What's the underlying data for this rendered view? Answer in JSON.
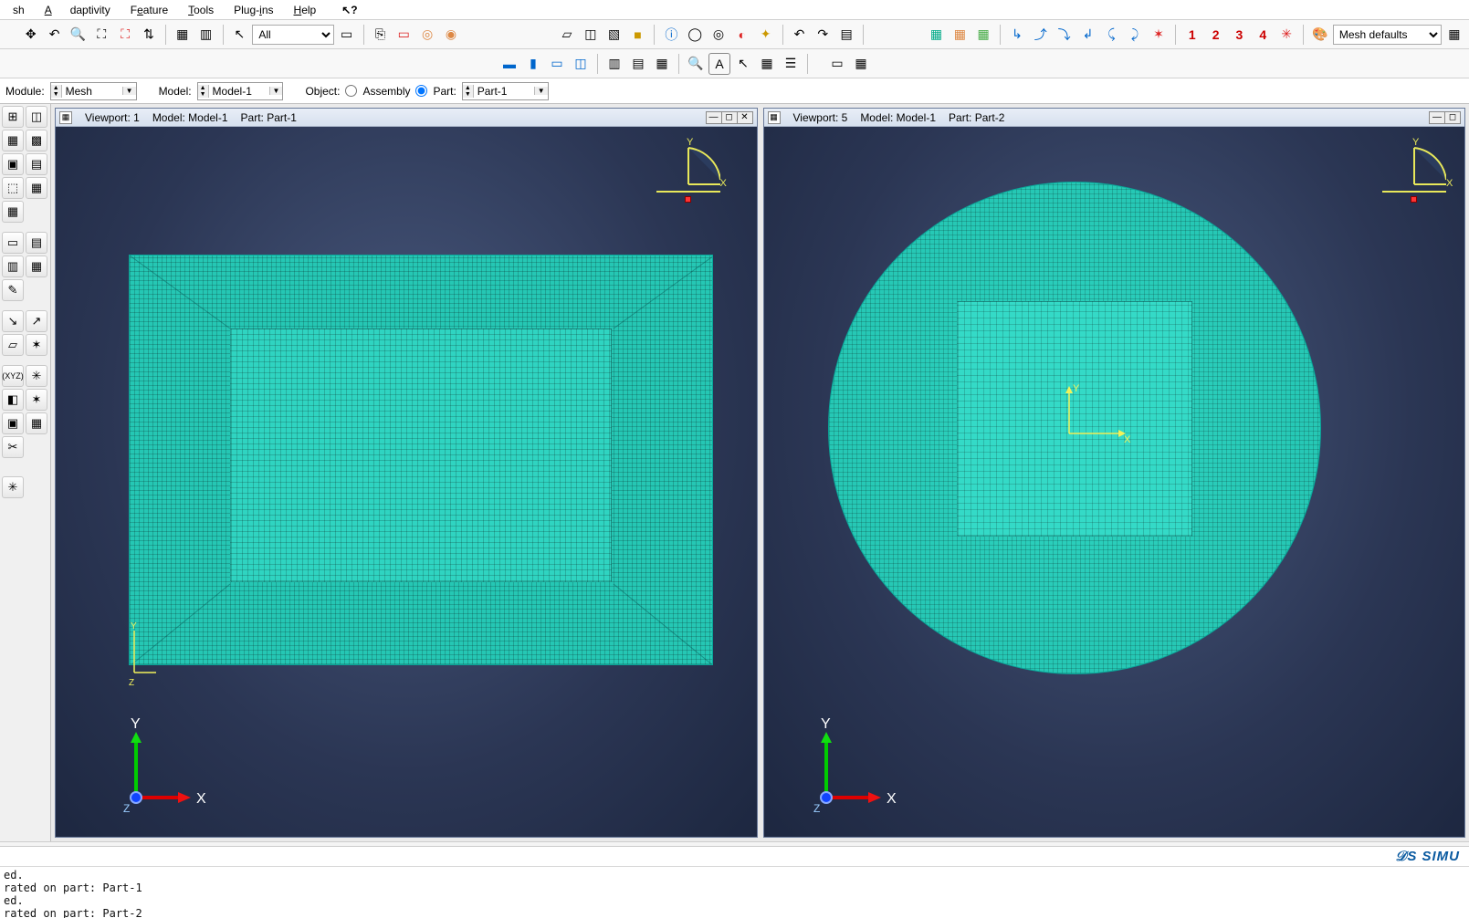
{
  "menu": {
    "items": [
      "sh",
      "Adaptivity",
      "Feature",
      "Tools",
      "Plug-ins",
      "Help"
    ],
    "help_marker": "⥀?"
  },
  "toolbar1": {
    "selector_label": "All",
    "render_style_label": "Mesh defaults"
  },
  "contextbar": {
    "module_label": "Module:",
    "module_value": "Mesh",
    "model_label": "Model:",
    "model_value": "Model-1",
    "object_label": "Object:",
    "assembly_label": "Assembly",
    "part_label": "Part:",
    "part_value": "Part-1"
  },
  "viewports": [
    {
      "id_label": "Viewport: 1",
      "model_label": "Model: Model-1",
      "part_label": "Part: Part-1",
      "x_axis": "X",
      "y_axis": "Y",
      "z_axis": "Z"
    },
    {
      "id_label": "Viewport: 5",
      "model_label": "Model: Model-1",
      "part_label": "Part: Part-2",
      "x_axis": "X",
      "y_axis": "Y",
      "z_axis": "Z"
    }
  ],
  "numbers": {
    "n1": "1",
    "n2": "2",
    "n3": "3",
    "n4": "4"
  },
  "brand": "𝒟S SIMU",
  "log": "ed.\nrated on part: Part-1\ned.\nrated on part: Part-2"
}
